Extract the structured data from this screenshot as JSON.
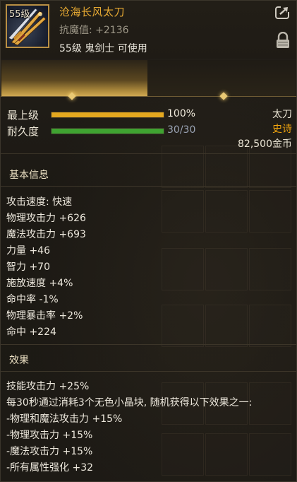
{
  "item": {
    "level_tag": "55级",
    "name": "沧海长风太刀",
    "magic_resist": "抗魔值: +2136",
    "usage": "55级 鬼剑士 可使用"
  },
  "header_icons": [
    "share-icon",
    "lock-icon"
  ],
  "bars": [
    {
      "label": "最上级",
      "value_text": "100%",
      "fill": 1.0,
      "color": "#e4a81f",
      "value_color": "#efe9da"
    },
    {
      "label": "耐久度",
      "value_text": "30/30",
      "fill": 1.0,
      "color": "#3fa331",
      "value_color": "#9aa3b4"
    }
  ],
  "right_info": {
    "type": "太刀",
    "rarity": "史诗",
    "rarity_color": "#f1a50e",
    "price": "82,500金币"
  },
  "basic_info": {
    "title": "基本信息",
    "lines": [
      "攻击速度: 快速",
      "物理攻击力 +626",
      "魔法攻击力 +693",
      "力量 +46",
      "智力 +70",
      "施放速度 +4%",
      "命中率 -1%",
      "物理暴击率 +2%",
      "命中 +224"
    ]
  },
  "effect": {
    "title": "效果",
    "lines": [
      "技能攻击力 +25%",
      "每30秒通过消耗3个无色小晶块, 随机获得以下效果之一:",
      "-物理和魔法攻击力 +15%",
      "-物理攻击力 +15%",
      "-魔法攻击力 +15%",
      "-所有属性强化 +32"
    ]
  }
}
